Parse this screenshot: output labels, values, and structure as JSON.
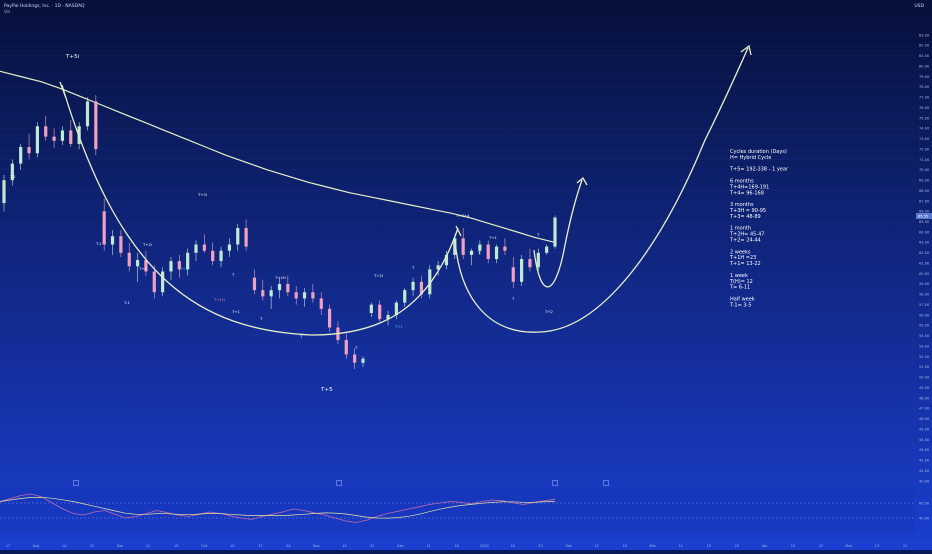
{
  "header": {
    "symbol_line": "PayPal Holdings, Inc. · 1D · NASDAQ",
    "sub_line": "Vol",
    "currency": "USD"
  },
  "colors": {
    "bg_top": "#07103a",
    "bg_bottom": "#1a3fd0",
    "up_candle": "#bfe9d2",
    "down_candle": "#f0a0c0",
    "curve": "#e6f0c8",
    "ma_line": "#e6f0c8",
    "label_white": "#ffffff",
    "label_cyan": "#4fb8ff",
    "label_pink": "#ff70b0",
    "rsi_line": "#c06aa8",
    "rsi_ma": "#e6e6a0"
  },
  "annotation": {
    "lines": [
      "Cycles duration (Days)",
      "H= Hybrid Cycle",
      "",
      "T+5= 192-338 - 1 year",
      "",
      "6 months",
      "T+4H=169-191",
      "T+4= 96-168",
      "",
      "3 months",
      "T+3H = 90-95",
      "T+3= 48-89",
      "",
      "1 month",
      "T+2H= 45-47",
      "T+2= 24-44",
      "",
      "2 weeks",
      "T+1H =23",
      "T+1= 13-22",
      "",
      "1 week",
      "T(H)= 12",
      "T= 6-11",
      "",
      "Half week",
      "T-1= 3-5"
    ]
  },
  "chart_data": {
    "type": "candlestick",
    "y_axis": {
      "ticks": [
        "83.00",
        "82.00",
        "81.00",
        "80.00",
        "79.00",
        "78.00",
        "77.00",
        "76.00",
        "75.00",
        "74.00",
        "73.00",
        "72.00",
        "71.00",
        "70.00",
        "69.00",
        "68.00",
        "67.00",
        "66.00",
        "65.00",
        "64.00",
        "63.00",
        "62.00",
        "61.00",
        "60.00",
        "59.00",
        "58.00",
        "57.00",
        "56.00",
        "55.00",
        "54.00",
        "53.00",
        "52.00",
        "51.00",
        "50.00",
        "49.00",
        "48.00",
        "47.00",
        "46.00",
        "45.00",
        "44.00",
        "43.00",
        "42.00",
        "41.00",
        "40.00"
      ],
      "ylim": [
        40,
        83
      ],
      "last_price": "65.55"
    },
    "x_axis": {
      "ticks": [
        "17",
        "Aug",
        "14",
        "22",
        "Sep",
        "11",
        "19",
        "Oct",
        "10",
        "17",
        "24",
        "Nov",
        "13",
        "21",
        "Dec",
        "11",
        "18",
        "2024",
        "16",
        "23",
        "Feb",
        "12",
        "19",
        "Mar",
        "11",
        "19",
        "25",
        "Apr",
        "15",
        "22",
        "May",
        "13",
        "21"
      ]
    },
    "series": [
      {
        "name": "candles",
        "values": [
          [
            66.8,
            69.5,
            66.0,
            69.0
          ],
          [
            69.0,
            71.0,
            68.5,
            70.6
          ],
          [
            70.6,
            72.5,
            70.0,
            72.2
          ],
          [
            72.2,
            73.5,
            71.0,
            71.6
          ],
          [
            71.6,
            74.6,
            71.2,
            74.2
          ],
          [
            74.2,
            75.2,
            72.8,
            73.2
          ],
          [
            73.2,
            74.0,
            72.1,
            72.8
          ],
          [
            72.8,
            74.2,
            72.4,
            73.8
          ],
          [
            73.8,
            74.8,
            72.2,
            72.5
          ],
          [
            72.5,
            74.6,
            72.0,
            74.2
          ],
          [
            74.2,
            77.0,
            73.8,
            76.6
          ],
          [
            76.6,
            77.2,
            71.4,
            72.0
          ],
          [
            66.0,
            67.2,
            62.2,
            62.8
          ],
          [
            62.8,
            64.2,
            61.8,
            63.6
          ],
          [
            63.6,
            64.2,
            61.6,
            62.0
          ],
          [
            62.0,
            63.0,
            60.2,
            60.7
          ],
          [
            60.7,
            62.0,
            59.2,
            61.3
          ],
          [
            61.3,
            62.2,
            59.8,
            60.2
          ],
          [
            60.2,
            60.8,
            57.6,
            58.2
          ],
          [
            58.2,
            60.6,
            57.8,
            60.2
          ],
          [
            60.2,
            61.6,
            59.4,
            61.2
          ],
          [
            61.2,
            61.8,
            59.6,
            60.4
          ],
          [
            60.4,
            62.4,
            59.8,
            62.0
          ],
          [
            62.0,
            63.2,
            61.2,
            62.8
          ],
          [
            62.8,
            63.8,
            62.0,
            62.2
          ],
          [
            62.2,
            63.0,
            60.8,
            61.2
          ],
          [
            61.2,
            62.6,
            60.6,
            62.2
          ],
          [
            62.2,
            63.4,
            61.6,
            62.8
          ],
          [
            62.8,
            64.8,
            62.2,
            64.4
          ],
          [
            64.4,
            65.2,
            62.2,
            62.6
          ],
          [
            59.6,
            60.4,
            58.0,
            58.4
          ],
          [
            58.4,
            59.4,
            57.4,
            57.8
          ],
          [
            57.8,
            58.8,
            56.6,
            58.4
          ],
          [
            58.4,
            59.6,
            57.6,
            59.0
          ],
          [
            59.0,
            59.8,
            57.8,
            58.2
          ],
          [
            58.2,
            58.8,
            57.0,
            57.6
          ],
          [
            57.6,
            58.6,
            56.8,
            58.2
          ],
          [
            58.2,
            59.0,
            57.2,
            57.6
          ],
          [
            57.6,
            58.2,
            56.0,
            56.6
          ],
          [
            56.6,
            57.0,
            54.4,
            54.8
          ],
          [
            54.8,
            55.4,
            53.2,
            53.6
          ],
          [
            53.6,
            54.2,
            51.8,
            52.2
          ],
          [
            52.2,
            52.8,
            50.8,
            51.4
          ],
          [
            51.4,
            52.0,
            51.0,
            51.8
          ],
          [
            56.2,
            57.2,
            55.8,
            57.0
          ],
          [
            57.0,
            57.4,
            55.4,
            55.6
          ],
          [
            55.6,
            56.4,
            55.0,
            56.0
          ],
          [
            56.0,
            57.4,
            55.6,
            57.2
          ],
          [
            57.2,
            58.6,
            56.8,
            58.4
          ],
          [
            58.4,
            59.6,
            57.8,
            59.2
          ],
          [
            59.2,
            59.8,
            57.6,
            58.0
          ],
          [
            58.0,
            60.8,
            57.6,
            60.4
          ],
          [
            60.4,
            61.2,
            59.8,
            60.8
          ],
          [
            60.8,
            62.2,
            60.4,
            61.8
          ],
          [
            61.8,
            63.8,
            61.4,
            63.4
          ],
          [
            63.4,
            64.4,
            61.4,
            61.8
          ],
          [
            61.8,
            62.4,
            60.8,
            62.2
          ],
          [
            62.2,
            63.2,
            61.8,
            62.8
          ],
          [
            62.8,
            63.2,
            61.0,
            61.4
          ],
          [
            61.4,
            62.8,
            61.0,
            62.6
          ],
          [
            62.6,
            63.4,
            61.8,
            62.2
          ],
          [
            60.6,
            61.6,
            58.6,
            59.2
          ],
          [
            59.2,
            61.8,
            58.8,
            61.4
          ],
          [
            61.4,
            62.4,
            60.2,
            60.6
          ],
          [
            60.6,
            62.4,
            60.2,
            62.0
          ],
          [
            62.0,
            62.8,
            61.8,
            62.6
          ],
          [
            62.6,
            65.6,
            62.4,
            65.4
          ]
        ]
      },
      {
        "name": "ma",
        "values": [
          79.5,
          79.0,
          78.5,
          77.8,
          77.0,
          76.2,
          75.4,
          74.6,
          73.8,
          73.0,
          72.2,
          71.4,
          70.7,
          70.0,
          69.4,
          68.8,
          68.3,
          67.8,
          67.4,
          67.0,
          66.6,
          66.2,
          65.8,
          65.3,
          64.7,
          64.1,
          63.5,
          63.0
        ]
      }
    ],
    "wave_labels": [
      {
        "text": "T+5i",
        "color": "white"
      },
      {
        "text": "T-1",
        "color": "white"
      },
      {
        "text": "T-1",
        "color": "white"
      },
      {
        "text": "T-1",
        "color": "white"
      },
      {
        "text": "T+1",
        "color": "white"
      },
      {
        "text": "T+2i",
        "color": "white"
      },
      {
        "text": "T+1",
        "color": "cyan"
      },
      {
        "text": "T+1H",
        "color": "pink"
      },
      {
        "text": "T",
        "color": "white"
      },
      {
        "text": "T+2H",
        "color": "white"
      },
      {
        "text": "T",
        "color": "white"
      },
      {
        "text": "T+1",
        "color": "white"
      },
      {
        "text": "T",
        "color": "white"
      },
      {
        "text": "T+5",
        "color": "white"
      },
      {
        "text": "T",
        "color": "white"
      },
      {
        "text": "T+2i",
        "color": "white"
      },
      {
        "text": "T+1",
        "color": "cyan"
      },
      {
        "text": "T",
        "color": "white"
      },
      {
        "text": "T+3+4",
        "color": "white"
      },
      {
        "text": "T",
        "color": "white"
      },
      {
        "text": "T+1",
        "color": "white"
      },
      {
        "text": "T",
        "color": "white"
      },
      {
        "text": "T",
        "color": "white"
      },
      {
        "text": "T+2",
        "color": "white"
      },
      {
        "text": "T+2i",
        "color": "white"
      }
    ],
    "cycle_curves": 4,
    "rsi": {
      "level_high": 60,
      "level_low": 40,
      "ticks": [
        "60.00",
        "40.00"
      ]
    }
  }
}
